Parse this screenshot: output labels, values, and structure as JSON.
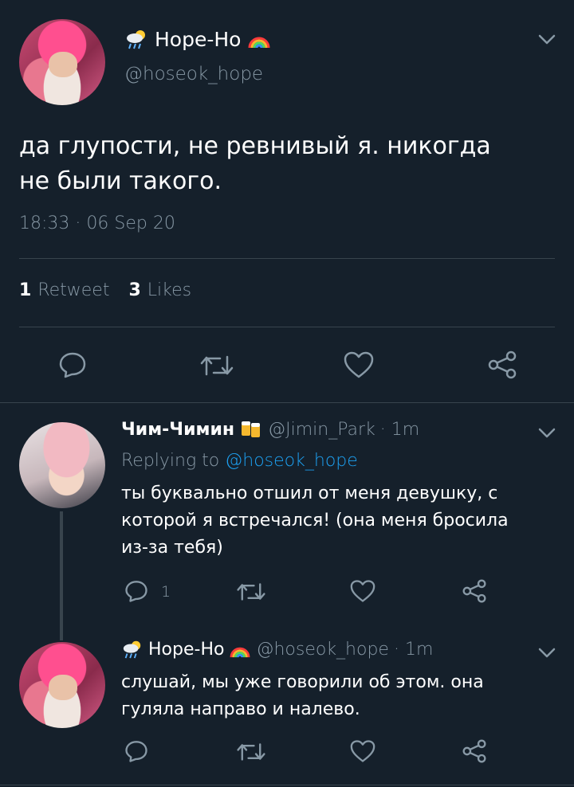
{
  "main_tweet": {
    "display_name": "Hope-Ho",
    "handle": "@hoseok_hope",
    "text_line1": "да глупости, не ревнивый я. никогда",
    "text_line2": "не были такого.",
    "timestamp": "18:33 · 06 Sep 20",
    "retweet_count": "1",
    "retweet_label": "Retweet",
    "like_count": "3",
    "like_label": "Likes"
  },
  "replies": [
    {
      "display_name": "Чим-Чимин",
      "handle": "@Jimin_Park",
      "time": "· 1m",
      "replying_prefix": "Replying to",
      "replying_to": "@hoseok_hope",
      "text_line1": "ты буквально отшил от меня девушку, с",
      "text_line2": "которой я встречался! (она меня бросила",
      "text_line3": "из-за тебя)",
      "reply_count": "1"
    },
    {
      "display_name": "Hope-Ho",
      "handle": "@hoseok_hope",
      "time": "· 1m",
      "text_line1": "слушай, мы уже говорили об этом. она",
      "text_line2": "гуляла направо и налево."
    }
  ],
  "colors": {
    "background": "#15202b",
    "muted": "#8899a6",
    "link": "#1da1f2",
    "divider": "#38444d"
  },
  "icons": [
    "cloud-rain-icon",
    "rainbow-icon",
    "beer-mugs-icon",
    "chevron-down-icon",
    "reply-icon",
    "retweet-icon",
    "like-icon",
    "share-icon"
  ]
}
